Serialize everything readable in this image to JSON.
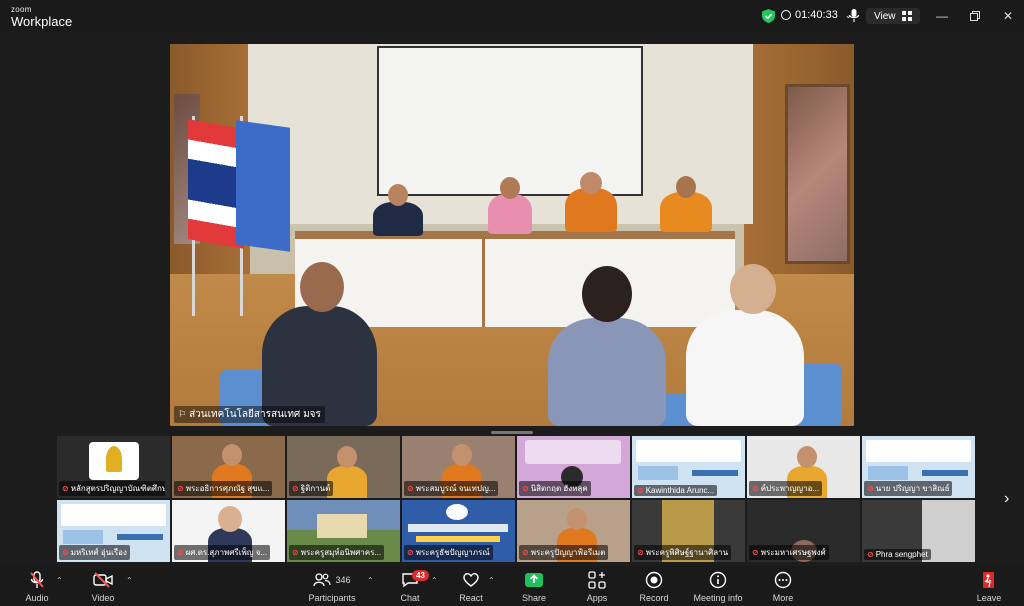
{
  "app": {
    "brand_top": "zoom",
    "brand_bottom": "Workplace"
  },
  "titlebar": {
    "timer": "01:40:33",
    "view_label": "View"
  },
  "main_video": {
    "participant_name": "ส่วนเทคโนโลยีสารสนเทศ มจร"
  },
  "gallery": {
    "tiles": [
      {
        "name": "หลักสูตรปริญญาบัณฑิตศึกษา...",
        "bg": "#2b2b2b",
        "kind": "logo"
      },
      {
        "name": "พระอธิการศุภณัฐ สุขแ...",
        "bg": "#8a6a4a",
        "kind": "monk"
      },
      {
        "name": "ฐิติกานต์",
        "bg": "#7a6a5a",
        "kind": "person"
      },
      {
        "name": "พระสมบูรณ์ จนเทปญ...",
        "bg": "#9a8070",
        "kind": "monk2"
      },
      {
        "name": "นิสิตกฤต ฮังหลุค",
        "bg": "#d3a8d8",
        "kind": "poster"
      },
      {
        "name": "Kawinthida Arunc...",
        "bg": "#cfe3f3",
        "kind": "slide"
      },
      {
        "name": "ค์ประพาญญาอ...",
        "bg": "#e8e8e8",
        "kind": "person2"
      },
      {
        "name": "นาย ปริญญา ขาสิณธ์",
        "bg": "#cfe3f3",
        "kind": "slide"
      },
      {
        "name": "มหริเทศ์ อุ่นเรือง",
        "bg": "#cfe3f3",
        "kind": "slide"
      },
      {
        "name": "ผศ.ดร.สุภาพศรีเพ็ญ จ...",
        "bg": "#f4f4f4",
        "kind": "woman"
      },
      {
        "name": "พระครูสมุห์อนิพศาคร...",
        "bg": "#6f8fb8",
        "kind": "temple"
      },
      {
        "name": "พระครูธัชปัญญาภรณ์",
        "bg": "#2f5da8",
        "kind": "banner"
      },
      {
        "name": "พระครูปัญญาฟ้อรีเมต",
        "bg": "#b8a08a",
        "kind": "monk3"
      },
      {
        "name": "พระครูพิศิษฐ์ฐานาศิลาน",
        "bg": "#3a3a3a",
        "kind": "dark"
      },
      {
        "name": "พระมหาเศรษฐพงศ์",
        "bg": "#2a2a2a",
        "kind": "darkface"
      },
      {
        "name": "Phra sengphet",
        "bg": "#3a3a3a",
        "kind": "room"
      }
    ]
  },
  "toolbar": {
    "audio": "Audio",
    "video": "Video",
    "participants": "Participants",
    "participants_count": "346",
    "chat": "Chat",
    "chat_badge": "43",
    "react": "React",
    "share": "Share",
    "apps": "Apps",
    "record": "Record",
    "meeting_info": "Meeting info",
    "more": "More",
    "leave": "Leave"
  },
  "colors": {
    "share_green": "#20c05c",
    "mute_red": "#ff4d4d",
    "shield_green": "#22c55e",
    "leave_red": "#e02828"
  }
}
